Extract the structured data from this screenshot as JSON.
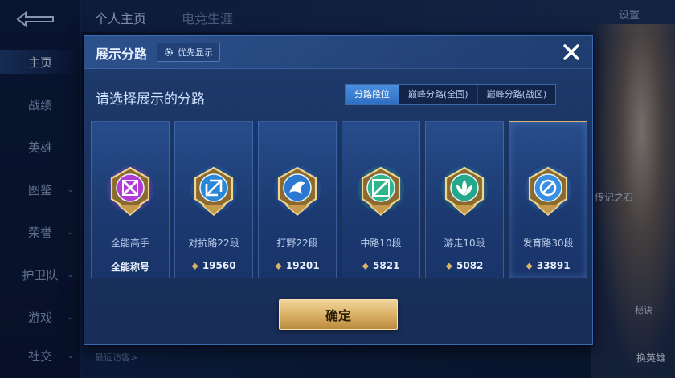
{
  "background": {
    "top_tabs": [
      "个人主页",
      "电竞生涯"
    ],
    "settings_label": "设置",
    "nav_items": [
      {
        "label": "主页",
        "chevron": false
      },
      {
        "label": "战绩",
        "chevron": false
      },
      {
        "label": "英雄",
        "chevron": false
      },
      {
        "label": "图鉴",
        "chevron": true
      },
      {
        "label": "荣誉",
        "chevron": true
      },
      {
        "label": "护卫队",
        "chevron": true
      },
      {
        "label": "游戏",
        "chevron": true
      },
      {
        "label": "社交",
        "chevron": true
      }
    ],
    "recent_visitors": "最近访客>",
    "side_tag": "传记之石",
    "small_button": "秘诀",
    "hero_button": "换英雄"
  },
  "modal": {
    "title": "展示分路",
    "priority_label": "优先显示",
    "subtitle": "请选择展示的分路",
    "segments": [
      {
        "label": "分路段位",
        "active": true
      },
      {
        "label": "巅峰分路(全国)",
        "active": false
      },
      {
        "label": "巅峰分路(战区)",
        "active": false
      }
    ],
    "cards": [
      {
        "name": "全能高手",
        "score": "全能称号",
        "show_coin": false,
        "emblem": "allround-emblem-icon",
        "color": "#b23bd6",
        "selected": false
      },
      {
        "name": "对抗路22段",
        "score": "19560",
        "show_coin": true,
        "emblem": "clash-lane-emblem-icon",
        "color": "#2a87d8",
        "selected": false
      },
      {
        "name": "打野22段",
        "score": "19201",
        "show_coin": true,
        "emblem": "jungle-emblem-icon",
        "color": "#2a78d0",
        "selected": false
      },
      {
        "name": "中路10段",
        "score": "5821",
        "show_coin": true,
        "emblem": "mid-lane-emblem-icon",
        "color": "#2eb58a",
        "selected": false
      },
      {
        "name": "游走10段",
        "score": "5082",
        "show_coin": true,
        "emblem": "roam-emblem-icon",
        "color": "#24a78a",
        "selected": false
      },
      {
        "name": "发育路30段",
        "score": "33891",
        "show_coin": true,
        "emblem": "farm-lane-emblem-icon",
        "color": "#3a8fe2",
        "selected": true
      }
    ],
    "confirm_label": "确定",
    "colors": {
      "accent": "#4a8fe0",
      "gold": "#d9b36a"
    }
  }
}
